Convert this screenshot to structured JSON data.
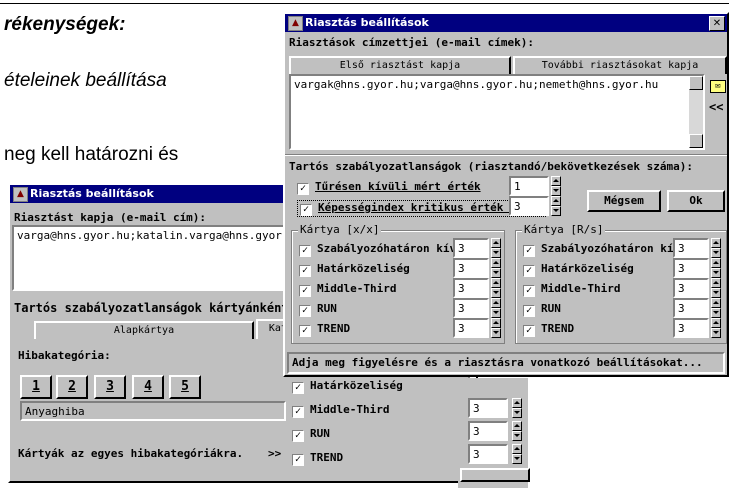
{
  "document": {
    "line1": "rékenységek:",
    "line2": "ételeinek beállítása",
    "line3": "neg kell határozni és"
  },
  "back_window": {
    "title": "Riasztás beállítások",
    "recipient_label": "Riasztást kapja (e-mail cím):",
    "recipient_value": "varga@hns.gyor.hu;katalin.varga@hns.gyor.hu;",
    "section_label": "Tartós szabályozatlanságok kártyánként (ri",
    "tabs": [
      "Alapkártya",
      "Kategória"
    ],
    "category_label": "Hibakategória:",
    "category_buttons": [
      "1",
      "2",
      "3",
      "4",
      "5"
    ],
    "category_value": "Anyaghiba",
    "cards_text": "Kártyák az egyes hibakategóriákra.",
    "cards_arrow": ">>",
    "checks": [
      {
        "label": "Határközeliség",
        "value": "3"
      },
      {
        "label": "Middle-Third",
        "value": "3"
      },
      {
        "label": "RUN",
        "value": "3"
      },
      {
        "label": "TREND",
        "value": "3"
      }
    ]
  },
  "front_window": {
    "title": "Riasztás beállítások",
    "close_icon": "✕",
    "recipients_label": "Riasztások címzettjei (e-mail címek):",
    "tabs": [
      "Első riasztást kapja",
      "További riasztásokat kapja"
    ],
    "email_value": "vargak@hns.gyor.hu;varga@hns.gyor.hu;nemeth@hns.gyor.hu",
    "side_arrow": "<<",
    "section_label": "Tartós szabályozatlanságok (riasztandó/bekövetkezések száma):",
    "checks_top": [
      {
        "label": "Tűrésen kívüli mért érték",
        "value": "1"
      },
      {
        "label": "Képességindex kritikus érték alatt",
        "value": "3"
      }
    ],
    "cancel_label": "Mégsem",
    "ok_label": "Ok",
    "group_left_title": "Kártya [x/x]",
    "group_right_title": "Kártya [R/s]",
    "group_items": [
      {
        "label": "Szabályozóhatáron kívül",
        "value": "3"
      },
      {
        "label": "Határközeliség",
        "value": "3"
      },
      {
        "label": "Middle-Third",
        "value": "3"
      },
      {
        "label": "RUN",
        "value": "3"
      },
      {
        "label": "TREND",
        "value": "3"
      }
    ],
    "status": "Adja meg figyelésre és a riasztásra vonatkozó beállításokat..."
  }
}
